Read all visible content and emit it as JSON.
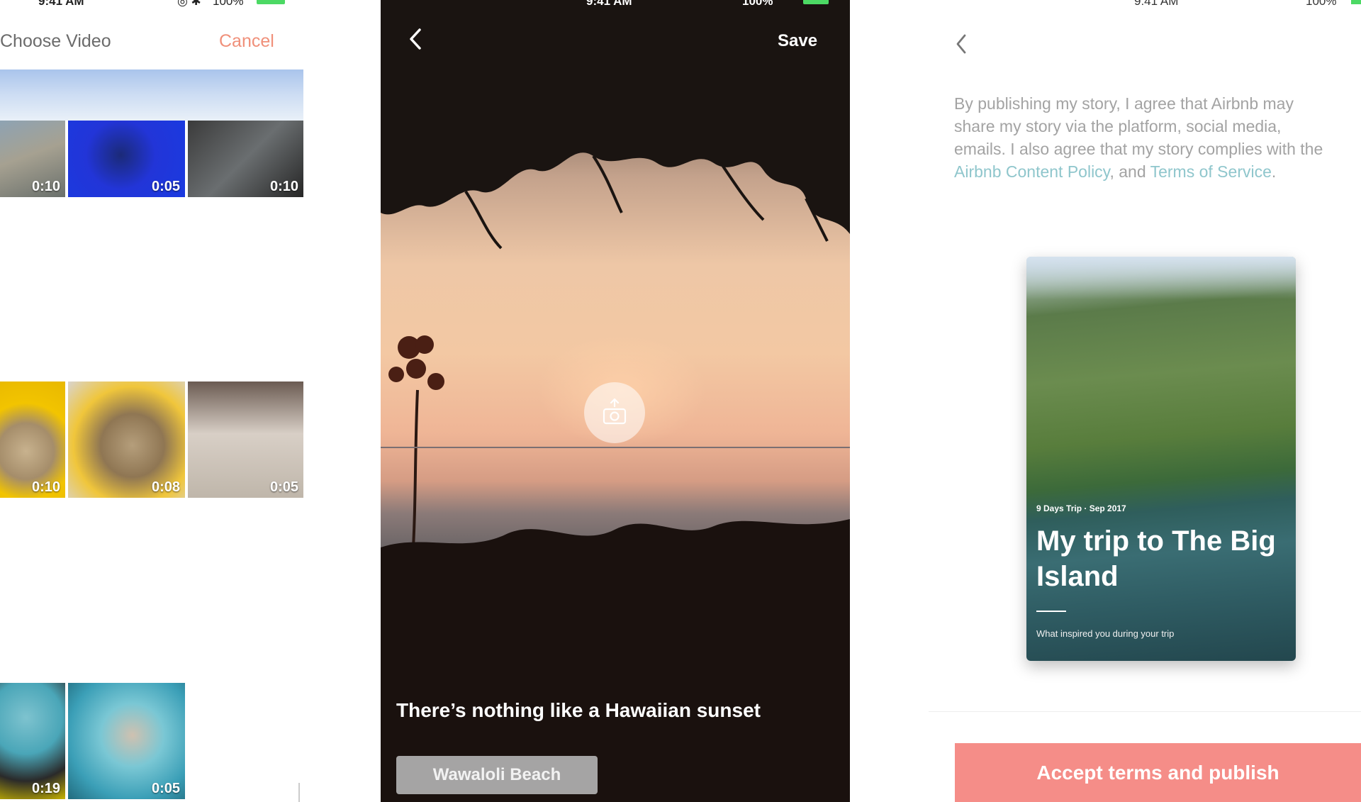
{
  "screen1": {
    "status_time": "9:41 AM",
    "status_battery": "100%",
    "title": "Choose Video",
    "cancel_label": "Cancel",
    "videos": [
      {
        "duration": "0:10"
      },
      {
        "duration": "0:05"
      },
      {
        "duration": "0:10"
      },
      {
        "duration": "0:10"
      },
      {
        "duration": "0:08"
      },
      {
        "duration": "0:05"
      },
      {
        "duration": "0:19"
      },
      {
        "duration": "0:05"
      }
    ]
  },
  "screen2": {
    "status_time": "9:41 AM",
    "status_battery": "100%",
    "save_label": "Save",
    "caption": "There’s nothing like a Hawaiian sunset",
    "location_tag": "Wawaloli Beach",
    "upload_icon": "camera-upload-icon"
  },
  "screen3": {
    "status_time": "9:41 AM",
    "status_battery": "100%",
    "terms_prefix": "By publishing my story, I agree that Airbnb may share my story via the platform, social media, emails. I also agree that my story complies with the ",
    "content_policy_link": "Airbnb Content Policy",
    "terms_mid": ", and ",
    "terms_link": "Terms of Service",
    "terms_suffix": ".",
    "card": {
      "meta": "9 Days Trip · Sep 2017",
      "title": "My trip to The Big Island",
      "subtitle": "What inspired you during your trip"
    },
    "accept_label": "Accept terms and publish"
  },
  "colors": {
    "accent_cancel": "#f0907a",
    "link": "#8fc6cc",
    "primary_button": "#f58d88",
    "battery": "#4cd964"
  }
}
